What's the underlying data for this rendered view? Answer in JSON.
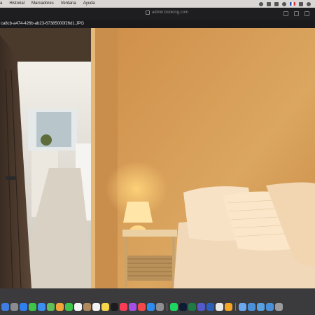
{
  "menubar": {
    "items": [
      "a",
      "Historial",
      "Marcadores",
      "Ventana",
      "Ayuda"
    ]
  },
  "browser": {
    "url": "admin.booking.com",
    "filename": "ca8cb-a474-426b-ab23-67385000f26d1.JPG"
  },
  "colors": {
    "wall_warm": "#d9a25a",
    "lamp_glow": "#ffd37a",
    "bedding": "#f1dcc0"
  },
  "dock": {
    "icons": [
      "finder-icon",
      "launchpad-icon",
      "safari-icon",
      "messages-icon",
      "mail-icon",
      "maps-icon",
      "photos-icon",
      "facetime-icon",
      "calendar-icon",
      "contacts-icon",
      "reminders-icon",
      "notes-icon",
      "tv-icon",
      "music-icon",
      "podcasts-icon",
      "news-icon",
      "app-store-icon",
      "settings-icon",
      "spotify-icon",
      "photoshop-icon",
      "excel-icon",
      "teams-icon",
      "word-icon",
      "chrome-icon",
      "pages-icon",
      "preview-icon",
      "folder-icon",
      "folder-icon-2",
      "folder-icon-3",
      "trash-icon"
    ],
    "colors": [
      "#3f7de0",
      "#8a8a8f",
      "#2f7ff0",
      "#3ec54a",
      "#3c8ef0",
      "#5fbf5a",
      "#f2a63a",
      "#3ec54a",
      "#f4f4f4",
      "#b08a5c",
      "#f2f2f2",
      "#f7d44a",
      "#1c1c1e",
      "#fa3c55",
      "#a450e6",
      "#f24a4a",
      "#2d8cf0",
      "#8e8e93",
      "#1ed760",
      "#0e1c33",
      "#1f7a45",
      "#5459c9",
      "#2b5fb8",
      "#e8e8e8",
      "#f5a623",
      "#6aa8f0",
      "#4a90d9",
      "#5aa0e0",
      "#4a90d9",
      "#9a9a9f"
    ]
  }
}
